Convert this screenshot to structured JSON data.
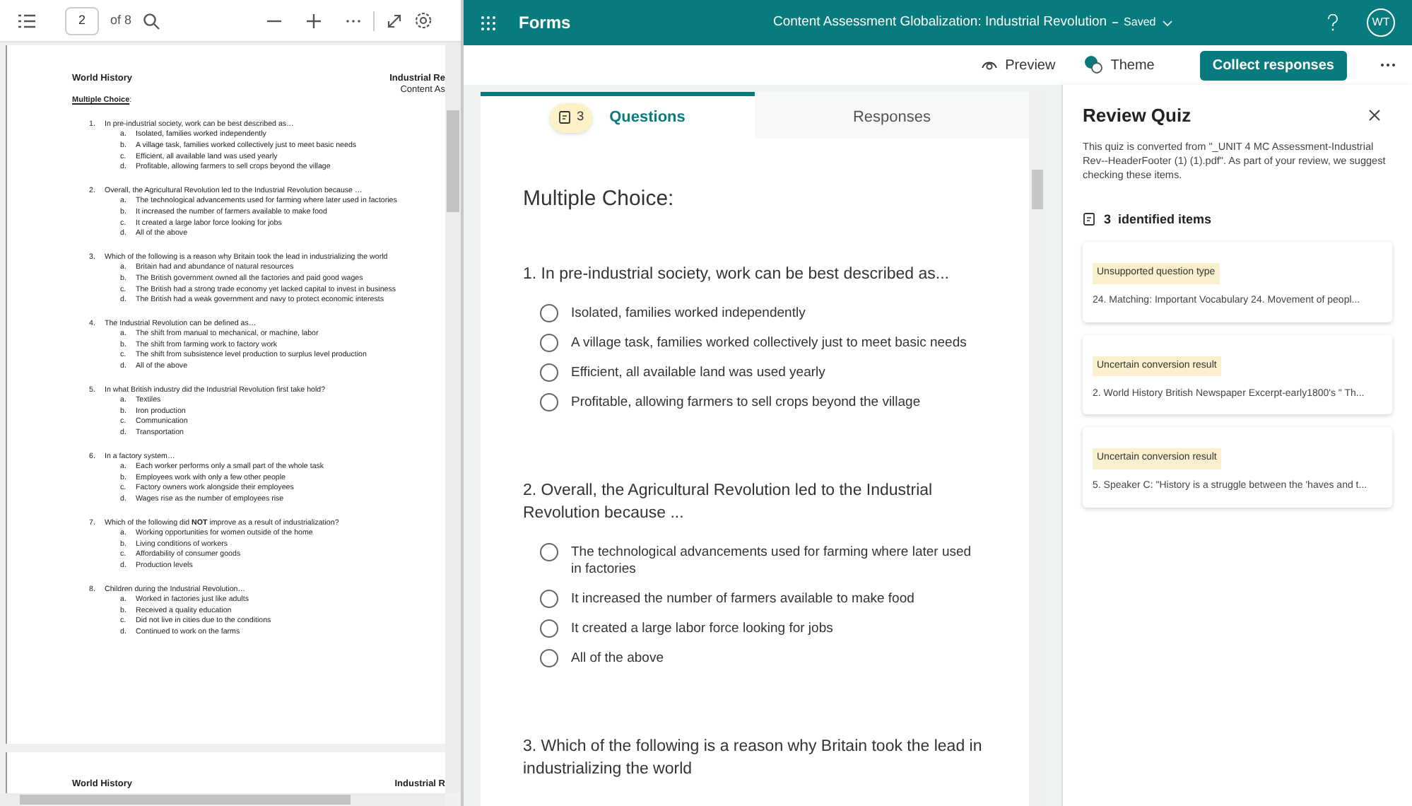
{
  "pdf_viewer": {
    "toolbar": {
      "page_number": "2",
      "page_count": "of 8"
    },
    "page": {
      "header_left": "World History",
      "header_right": [
        "Industrial Re",
        "Content As"
      ],
      "section": "Multiple Choice",
      "section_suffix": ":",
      "questions": [
        {
          "number": "1.",
          "text": "In pre-industrial society, work can be best described as…",
          "options": [
            {
              "letter": "a.",
              "text": "Isolated, families worked independently"
            },
            {
              "letter": "b.",
              "text": "A village task, families worked collectively just to meet basic needs"
            },
            {
              "letter": "c.",
              "text": "Efficient, all available land was used yearly"
            },
            {
              "letter": "d.",
              "text": "Profitable, allowing farmers to sell crops beyond the village"
            }
          ]
        },
        {
          "number": "2.",
          "text": "Overall, the Agricultural Revolution led to the Industrial Revolution because …",
          "options": [
            {
              "letter": "a.",
              "text": "The technological advancements used for farming where later used in factories"
            },
            {
              "letter": "b.",
              "text": "It increased the number of farmers available to make food"
            },
            {
              "letter": "c.",
              "text": "It created a large labor force looking for jobs"
            },
            {
              "letter": "d.",
              "text": "All of the above"
            }
          ]
        },
        {
          "number": "3.",
          "text": "Which of the following is a reason why Britain took the lead in industrializing the world",
          "options": [
            {
              "letter": "a.",
              "text": "Britain had and abundance of natural resources"
            },
            {
              "letter": "b.",
              "text": "The British government owned all the factories and paid good wages"
            },
            {
              "letter": "c.",
              "text": "The British had a strong trade economy yet lacked capital to invest in business"
            },
            {
              "letter": "d.",
              "text": "The British had a weak government and navy to protect economic interests"
            }
          ]
        },
        {
          "number": "4.",
          "text": "The Industrial Revolution can be defined as…",
          "options": [
            {
              "letter": "a.",
              "text": "The shift from manual to mechanical, or machine, labor"
            },
            {
              "letter": "b.",
              "text": "The shift from farming work to factory work"
            },
            {
              "letter": "c.",
              "text": "The shift from subsistence level production to surplus level production"
            },
            {
              "letter": "d.",
              "text": "All of the above"
            }
          ]
        },
        {
          "number": "5.",
          "text": "In what British industry did the Industrial Revolution first take hold?",
          "options": [
            {
              "letter": "a.",
              "text": "Textiles"
            },
            {
              "letter": "b.",
              "text": "Iron production"
            },
            {
              "letter": "c.",
              "text": "Communication"
            },
            {
              "letter": "d.",
              "text": "Transportation"
            }
          ]
        },
        {
          "number": "6.",
          "text": "In a factory system…",
          "options": [
            {
              "letter": "a.",
              "text": "Each worker performs only a small part of the whole task"
            },
            {
              "letter": "b.",
              "text": "Employees work with only a few other people"
            },
            {
              "letter": "c.",
              "text": "Factory owners work alongside their employees"
            },
            {
              "letter": "d.",
              "text": "Wages rise as the number of employees rise"
            }
          ]
        },
        {
          "number": "7.",
          "text": "Which of the following did **NOT** improve as a result of industrialization?",
          "options": [
            {
              "letter": "a.",
              "text": "Working opportunities for women outside of the home"
            },
            {
              "letter": "b.",
              "text": "Living conditions of workers"
            },
            {
              "letter": "c.",
              "text": "Affordability of consumer goods"
            },
            {
              "letter": "d.",
              "text": "Production levels"
            }
          ]
        },
        {
          "number": "8.",
          "text": "Children during the Industrial Revolution…",
          "options": [
            {
              "letter": "a.",
              "text": "Worked in factories just like adults"
            },
            {
              "letter": "b.",
              "text": "Received a quality education"
            },
            {
              "letter": "c.",
              "text": "Did not live in cities due to the conditions"
            },
            {
              "letter": "d.",
              "text": "Continued to work on the farms"
            }
          ]
        }
      ]
    },
    "next_page": {
      "header_left": "World History",
      "header_right": "Industrial R"
    }
  },
  "forms": {
    "app_name": "Forms",
    "form_title": "Content Assessment Globalization: Industrial Revolution",
    "save_status": "Saved",
    "avatar": "WT",
    "toolbar": {
      "preview": "Preview",
      "theme": "Theme",
      "collect": "Collect responses"
    },
    "tabs": [
      {
        "label": "Questions",
        "badge": "3",
        "selected": true
      },
      {
        "label": "Responses",
        "selected": false
      }
    ],
    "section_title": "Multiple Choice:",
    "questions": [
      {
        "title": "1. In pre-industrial society, work can be best described as...",
        "options": [
          {
            "text": "Isolated, families worked independently",
            "selected": false
          },
          {
            "text": "A village task, families worked collectively just to meet basic needs",
            "selected": false
          },
          {
            "text": "Efficient, all available land was used yearly",
            "selected": false
          },
          {
            "text": "Profitable, allowing farmers to sell crops beyond the village",
            "selected": false
          }
        ]
      },
      {
        "title": "2. Overall, the Agricultural Revolution led to the Industrial Revolution because ...",
        "options": [
          {
            "text": "The technological advancements used for farming where later used in factories",
            "selected": false
          },
          {
            "text": "It increased the number of farmers available to make food",
            "selected": false
          },
          {
            "text": "It created a large labor force looking for jobs",
            "selected": false
          },
          {
            "text": "All of the above",
            "selected": false
          }
        ]
      },
      {
        "title": "3. Which of the following is a reason why Britain took the lead in industrializing the world"
      }
    ]
  },
  "review_panel": {
    "title": "Review Quiz",
    "description": "This quiz is converted from \"_UNIT 4 MC Assessment-Industrial Rev--HeaderFooter (1) (1).pdf\". As part of your review, we suggest checking these items.",
    "count": "3",
    "count_label": "identified items",
    "items": [
      {
        "tag": "Unsupported question type",
        "text": "24. Matching: Important Vocabulary 24. Movement of peopl..."
      },
      {
        "tag": "Uncertain conversion result",
        "text": "2. World History British Newspaper Excerpt-early1800's \" Th..."
      },
      {
        "tag": "Uncertain conversion result",
        "text": "5. Speaker C: \"History is a struggle between the 'haves and t..."
      }
    ]
  }
}
